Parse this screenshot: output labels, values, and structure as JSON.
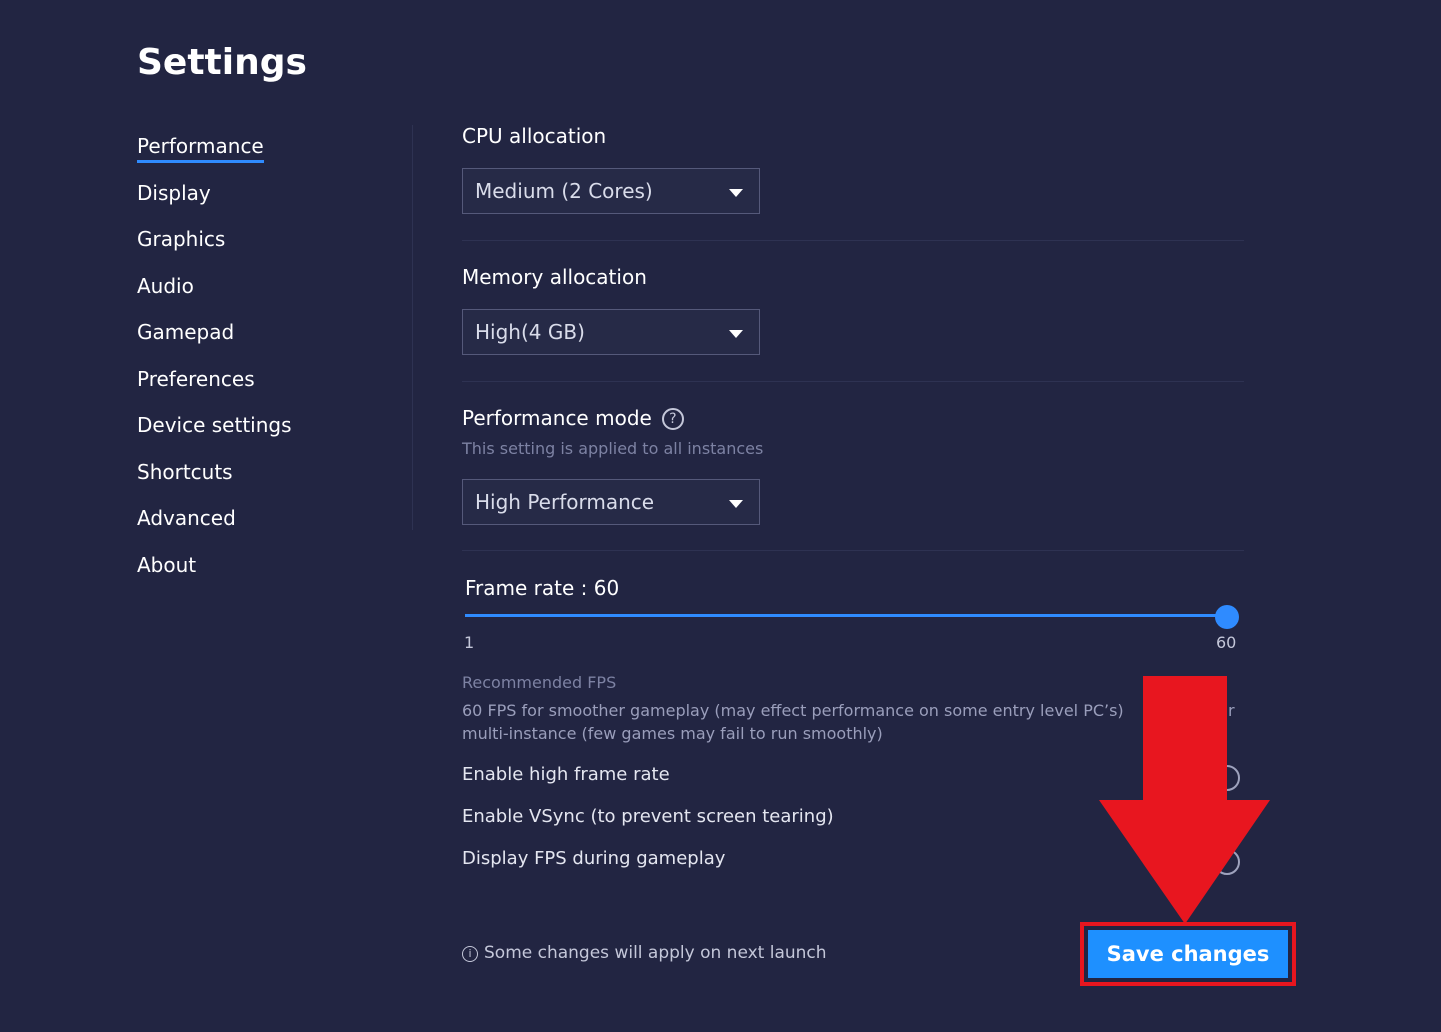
{
  "page": {
    "title": "Settings"
  },
  "sidebar": {
    "items": [
      {
        "label": "Performance",
        "active": true
      },
      {
        "label": "Display"
      },
      {
        "label": "Graphics"
      },
      {
        "label": "Audio"
      },
      {
        "label": "Gamepad"
      },
      {
        "label": "Preferences"
      },
      {
        "label": "Device settings"
      },
      {
        "label": "Shortcuts"
      },
      {
        "label": "Advanced"
      },
      {
        "label": "About"
      }
    ]
  },
  "cpu": {
    "label": "CPU allocation",
    "value": "Medium (2 Cores)"
  },
  "memory": {
    "label": "Memory allocation",
    "value": "High(4 GB)"
  },
  "perf_mode": {
    "label": "Performance mode",
    "help_icon": "?",
    "subtitle": "This setting is applied to all instances",
    "value": "High Performance"
  },
  "frame_rate": {
    "label": "Frame rate : 60",
    "min_label": "1",
    "max_label": "60",
    "value": 60,
    "min": 1,
    "max": 60
  },
  "recommended": {
    "heading": "Recommended FPS",
    "line1": "60 FPS for smoother gameplay (may effect performance on some entry level PC’s)",
    "line1_tail": "r",
    "line2": "multi-instance (few games may fail to run smoothly)"
  },
  "toggles": {
    "high_frame_rate": "Enable high frame rate",
    "vsync": "Enable VSync (to prevent screen tearing)",
    "display_fps": "Display FPS during gameplay"
  },
  "footer": {
    "info_icon": "i",
    "note": "Some changes will apply on next launch",
    "save_label": "Save changes"
  },
  "colors": {
    "background": "#222542",
    "accent": "#1e90ff",
    "annotation_red": "#e8161f"
  }
}
